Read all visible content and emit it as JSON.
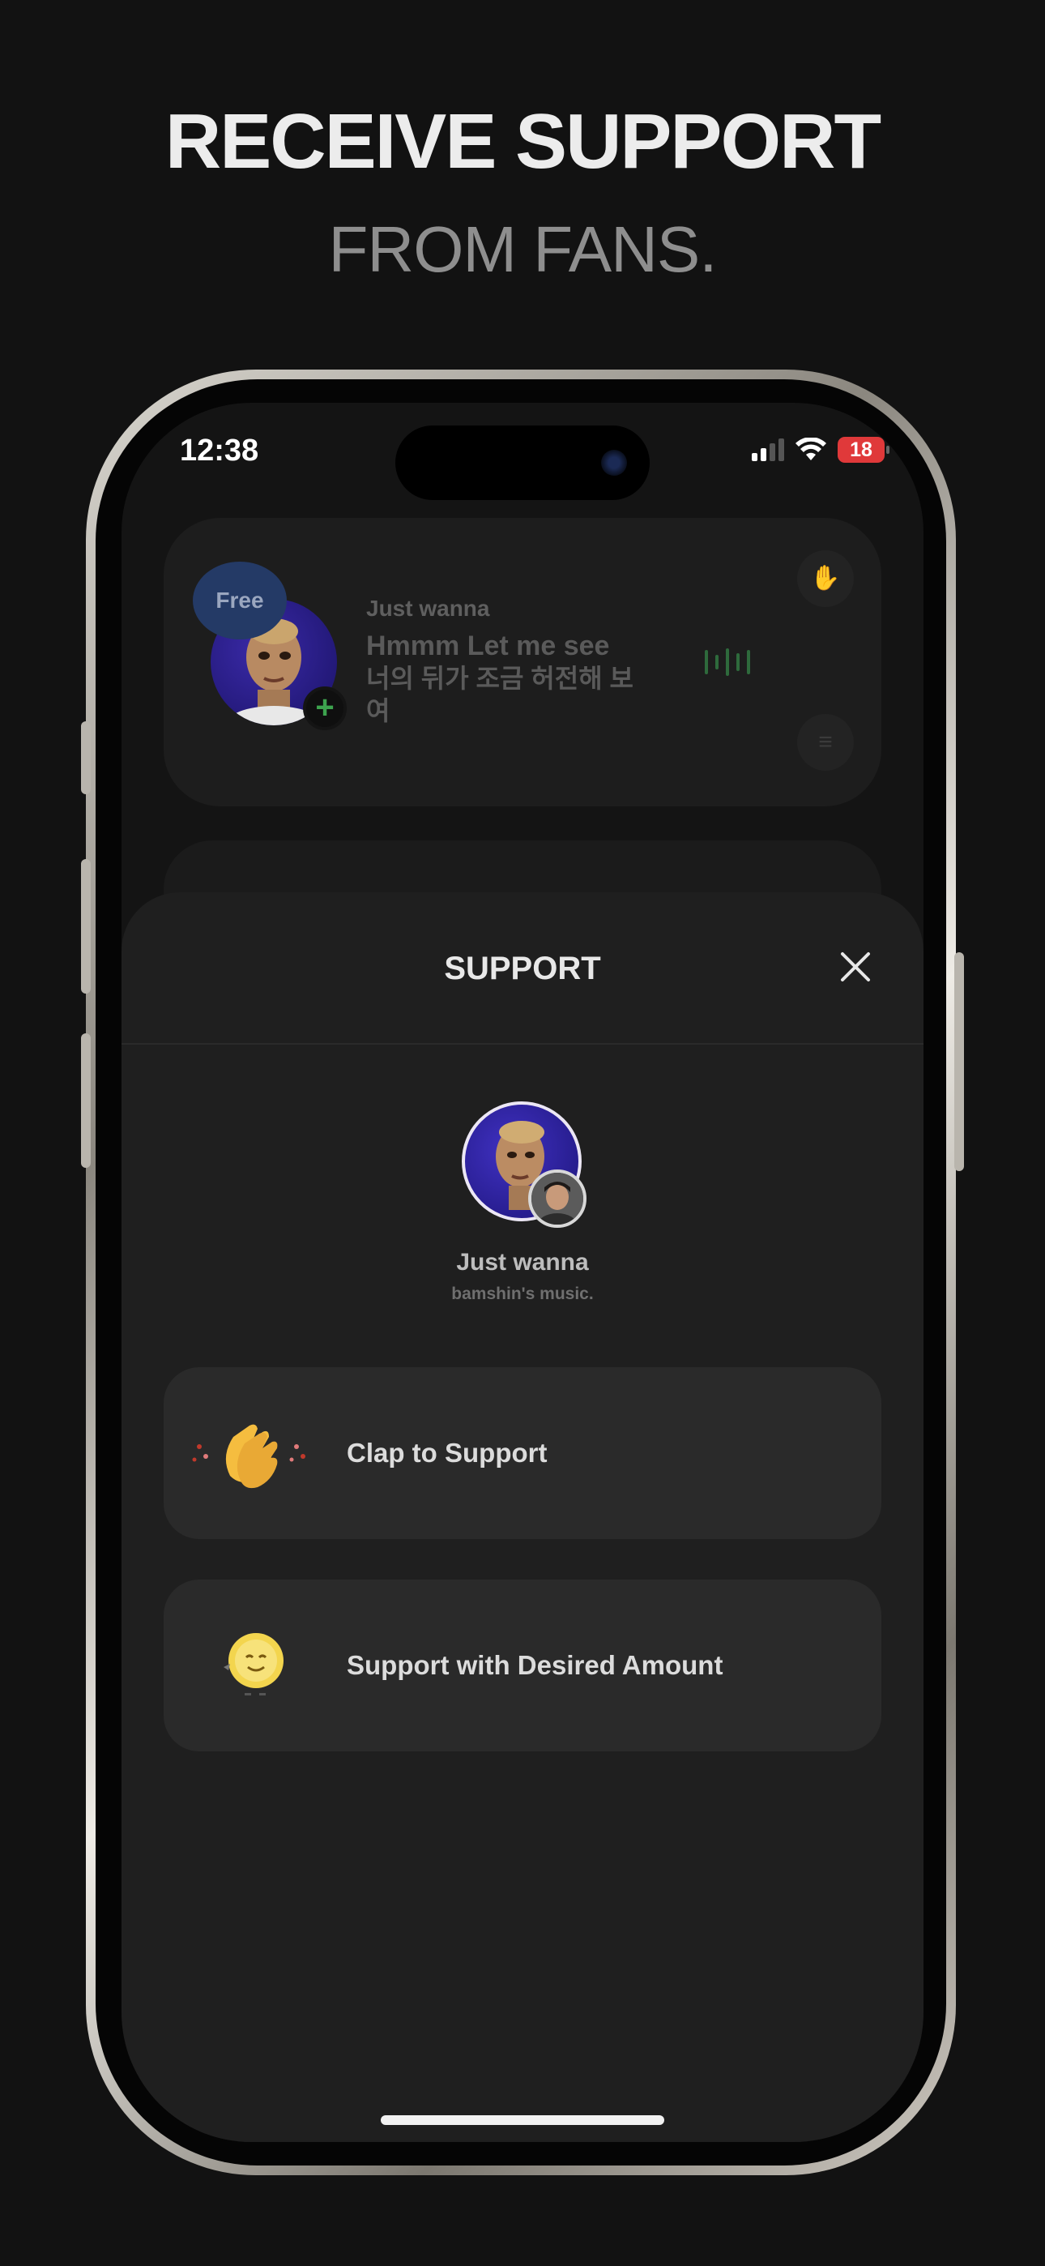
{
  "promo": {
    "headline": "RECEIVE SUPPORT",
    "subline": "FROM FANS."
  },
  "status_bar": {
    "time": "12:38",
    "battery": "18",
    "battery_color": "#e0393a"
  },
  "background_card": {
    "badge": "Free",
    "artist": "Just wanna",
    "lyric_line1": "Hmmm Let me see",
    "lyric_line2": "너의 뒤가 조금 허전해 보",
    "lyric_line3": "여",
    "icons": [
      "clap-icon",
      "menu-icon",
      "add-icon",
      "waveform-icon"
    ]
  },
  "sheet": {
    "title": "SUPPORT",
    "artist": "Just wanna",
    "album": "bamshin's music.",
    "options": [
      {
        "label": "Clap to Support",
        "icon": "clap-emoji-icon"
      },
      {
        "label": "Support with Desired Amount",
        "icon": "coin-emoji-icon"
      }
    ]
  },
  "colors": {
    "background": "#121212",
    "sheet": "#1f1f1f",
    "option": "#2a2a2a",
    "accent_green": "#3da34e"
  }
}
